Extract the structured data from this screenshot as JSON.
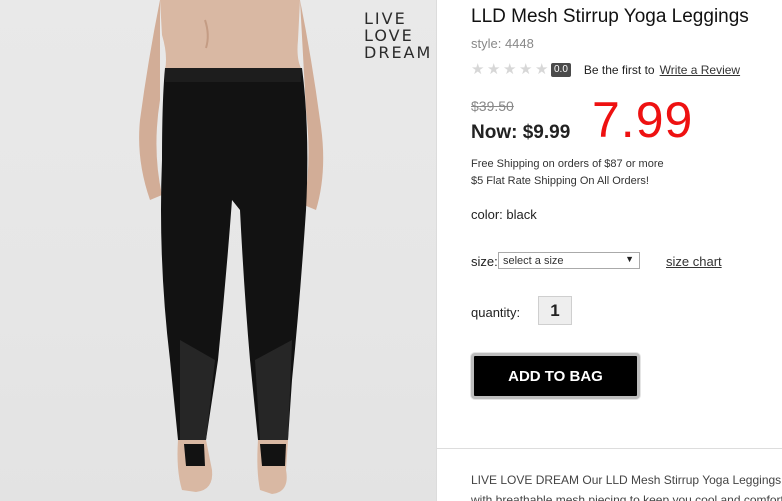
{
  "brand": {
    "logo_lines": [
      "LIVE",
      "LOVE",
      "DREAM"
    ]
  },
  "product": {
    "title": "LLD Mesh Stirrup Yoga Leggings",
    "style_label": "style: 4448",
    "image_name": "model-wearing-black-mesh-stirrup-leggings"
  },
  "rating": {
    "stars_filled": 0,
    "stars_total": 5,
    "badge": "0.0",
    "prompt_text": "Be the first to",
    "write_review_link": "Write a Review"
  },
  "pricing": {
    "original_price": "$39.50",
    "now_price": "Now: $9.99",
    "sale_overlay": "7.99",
    "sale_color": "#ee1111"
  },
  "shipping": {
    "line1": "Free Shipping on orders of $87 or more",
    "line2": "$5 Flat Rate Shipping On All Orders!"
  },
  "options": {
    "color_text": "color: black",
    "size_label": "size:",
    "size_selected": "select a size",
    "size_chart_link": "size chart",
    "quantity_label": "quantity:",
    "quantity_value": "1"
  },
  "actions": {
    "add_to_bag_label": "ADD TO BAG"
  },
  "description": {
    "text": "LIVE LOVE DREAM Our LLD Mesh Stirrup Yoga Leggings up",
    "text_line2": "with breathable mesh piecing to keep you cool and comfort"
  }
}
